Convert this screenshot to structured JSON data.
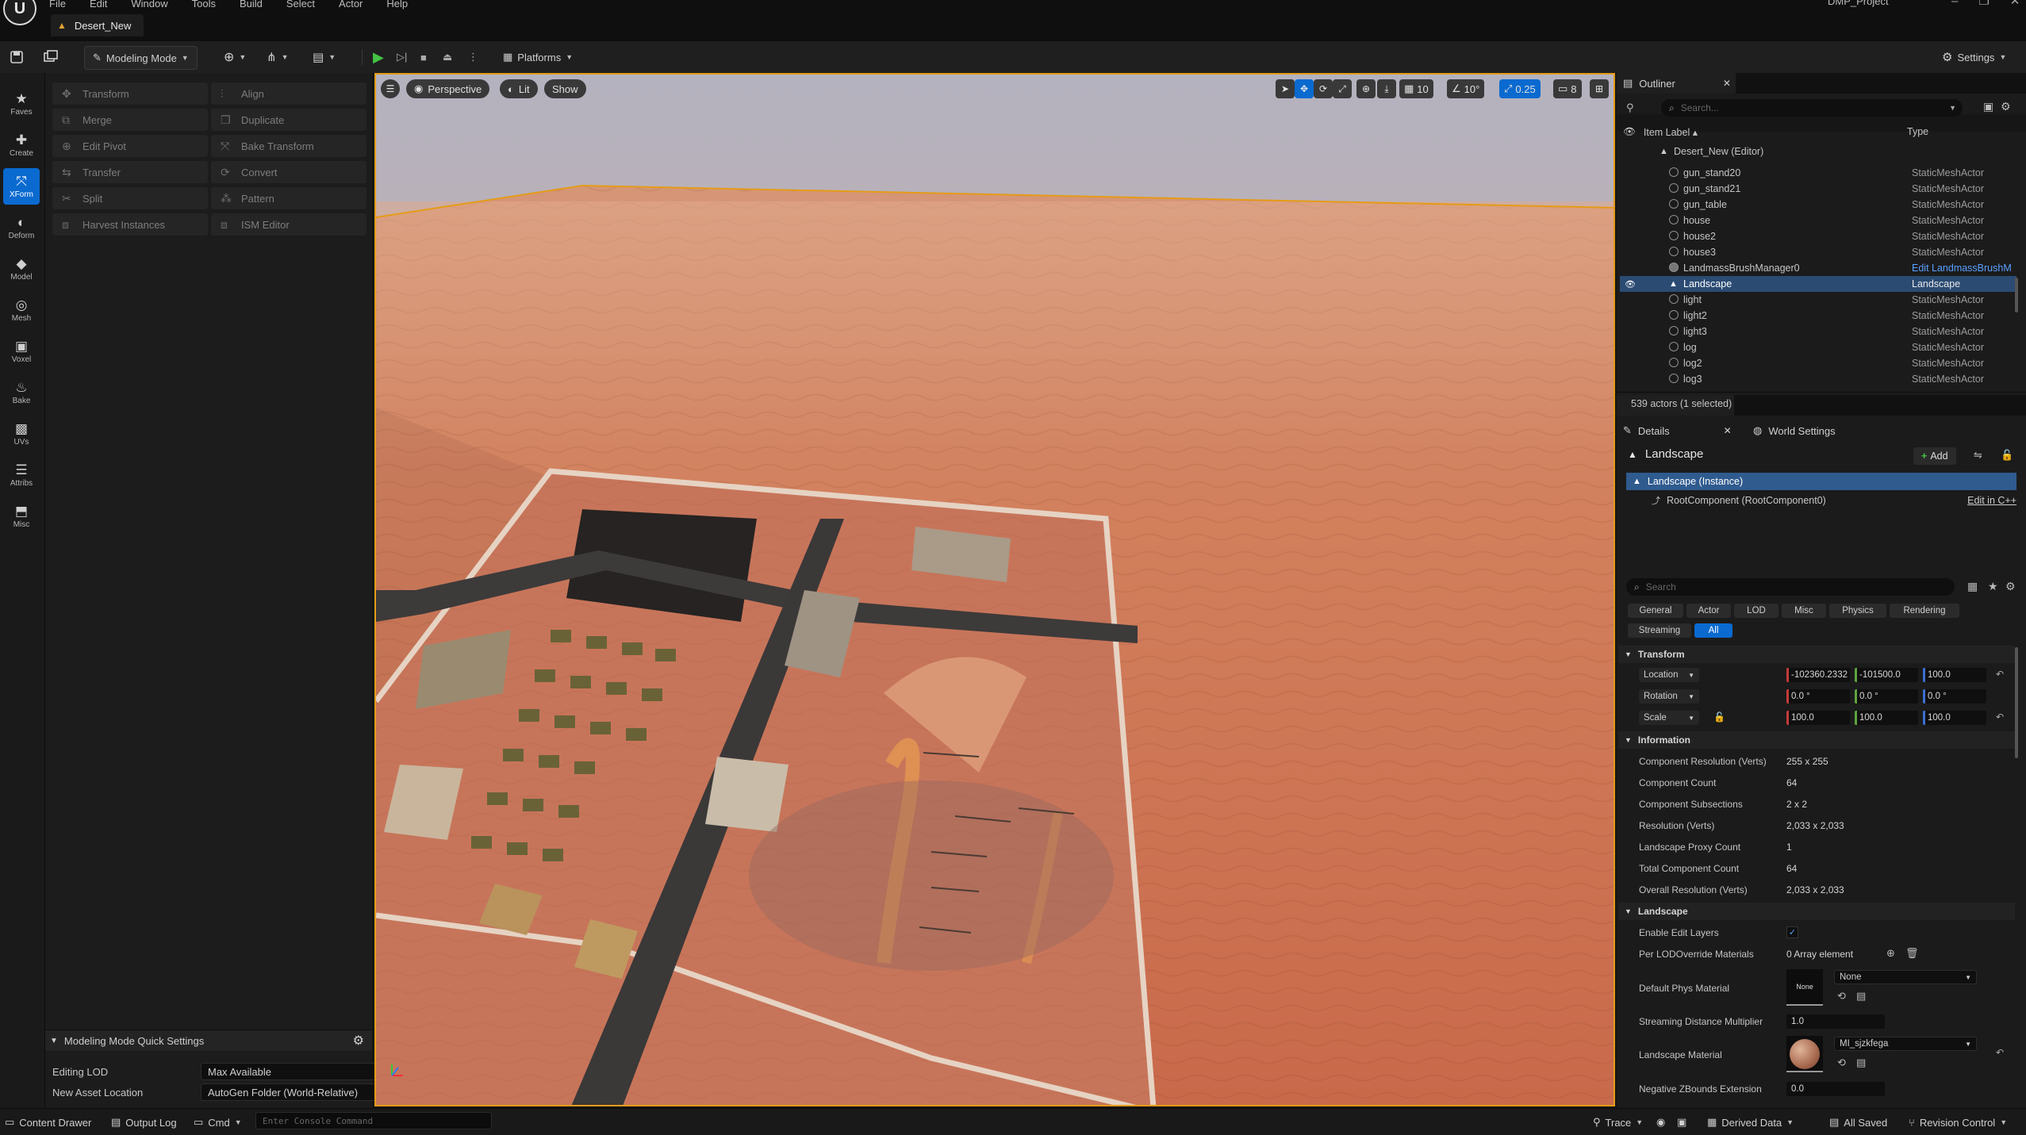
{
  "window": {
    "project_name": "DMP_Project",
    "level_tab": "Desert_New",
    "menu": [
      "File",
      "Edit",
      "Window",
      "Tools",
      "Build",
      "Select",
      "Actor",
      "Help"
    ]
  },
  "toolbar": {
    "mode": "Modeling Mode",
    "platforms": "Platforms",
    "settings": "Settings"
  },
  "rail": [
    {
      "label": "Faves",
      "icon": "star-icon"
    },
    {
      "label": "Create",
      "icon": "create-icon"
    },
    {
      "label": "XForm",
      "icon": "xform-icon",
      "active": true
    },
    {
      "label": "Deform",
      "icon": "deform-icon"
    },
    {
      "label": "Model",
      "icon": "model-icon"
    },
    {
      "label": "Mesh",
      "icon": "mesh-icon"
    },
    {
      "label": "Voxel",
      "icon": "voxel-icon"
    },
    {
      "label": "Bake",
      "icon": "bake-icon"
    },
    {
      "label": "UVs",
      "icon": "uvs-icon"
    },
    {
      "label": "Attribs",
      "icon": "attribs-icon"
    },
    {
      "label": "Misc",
      "icon": "misc-icon"
    }
  ],
  "palette": {
    "left": [
      "Transform",
      "Merge",
      "Edit Pivot",
      "Transfer",
      "Split",
      "Harvest Instances"
    ],
    "right": [
      "Align",
      "Duplicate",
      "Bake Transform",
      "Convert",
      "Pattern",
      "ISM Editor"
    ]
  },
  "quick_settings": {
    "header": "Modeling Mode Quick Settings",
    "editing_lod_label": "Editing LOD",
    "editing_lod_value": "Max Available",
    "asset_location_label": "New Asset Location",
    "asset_location_value": "AutoGen Folder (World-Relative)"
  },
  "viewport": {
    "perspective": "Perspective",
    "lit": "Lit",
    "show": "Show",
    "grid_snap": "10",
    "rot_snap": "10°",
    "scale_snap": "0.25",
    "camera_speed": "8"
  },
  "outliner": {
    "title": "Outliner",
    "search_placeholder": "Search...",
    "col_label": "Item Label ▴",
    "col_type": "Type",
    "root": "Desert_New (Editor)",
    "rows": [
      {
        "name": "gun_stand20",
        "type": "StaticMeshActor"
      },
      {
        "name": "gun_stand21",
        "type": "StaticMeshActor"
      },
      {
        "name": "gun_table",
        "type": "StaticMeshActor"
      },
      {
        "name": "house",
        "type": "StaticMeshActor"
      },
      {
        "name": "house2",
        "type": "StaticMeshActor"
      },
      {
        "name": "house3",
        "type": "StaticMeshActor"
      },
      {
        "name": "LandmassBrushManager0",
        "type": "Edit LandmassBrushM"
      },
      {
        "name": "Landscape",
        "type": "Landscape",
        "selected": true
      },
      {
        "name": "light",
        "type": "StaticMeshActor"
      },
      {
        "name": "light2",
        "type": "StaticMeshActor"
      },
      {
        "name": "light3",
        "type": "StaticMeshActor"
      },
      {
        "name": "log",
        "type": "StaticMeshActor"
      },
      {
        "name": "log2",
        "type": "StaticMeshActor"
      },
      {
        "name": "log3",
        "type": "StaticMeshActor"
      }
    ],
    "footer": "539 actors (1 selected)"
  },
  "details": {
    "tab": "Details",
    "world_tab": "World Settings",
    "actor_name": "Landscape",
    "add_label": "Add",
    "instance": "Landscape (Instance)",
    "root_component": "RootComponent (RootComponent0)",
    "edit_cpp": "Edit in C++",
    "search_placeholder": "Search",
    "filters": [
      "General",
      "Actor",
      "LOD",
      "Misc",
      "Physics",
      "Rendering",
      "Streaming",
      "All"
    ],
    "transform": {
      "header": "Transform",
      "location_label": "Location",
      "rotation_label": "Rotation",
      "scale_label": "Scale",
      "location": [
        "-102360.2332",
        "-101500.0",
        "100.0"
      ],
      "rotation": [
        "0.0 °",
        "0.0 °",
        "0.0 °"
      ],
      "scale": [
        "100.0",
        "100.0",
        "100.0"
      ]
    },
    "information": {
      "header": "Information",
      "rows": [
        {
          "label": "Component Resolution (Verts)",
          "value": "255 x 255"
        },
        {
          "label": "Component Count",
          "value": "64"
        },
        {
          "label": "Component Subsections",
          "value": "2 x 2"
        },
        {
          "label": "Resolution (Verts)",
          "value": "2,033 x 2,033"
        },
        {
          "label": "Landscape Proxy Count",
          "value": "1"
        },
        {
          "label": "Total Component Count",
          "value": "64"
        },
        {
          "label": "Overall Resolution (Verts)",
          "value": "2,033 x 2,033"
        }
      ]
    },
    "landscape": {
      "header": "Landscape",
      "enable_edit_layers": "Enable Edit Layers",
      "per_lod_override": "Per LODOverride Materials",
      "array_elements": "0 Array element",
      "default_phys_material": "Default Phys Material",
      "phys_thumb": "None",
      "phys_value": "None",
      "streaming_multiplier_label": "Streaming Distance Multiplier",
      "streaming_multiplier": "1.0",
      "material_label": "Landscape Material",
      "material_value": "MI_sjzkfega",
      "negative_z_label": "Negative ZBounds Extension",
      "negative_z": "0.0"
    }
  },
  "statusbar": {
    "content_drawer": "Content Drawer",
    "output_log": "Output Log",
    "cmd": "Cmd",
    "console_placeholder": "Enter Console Command",
    "trace": "Trace",
    "derived_data": "Derived Data",
    "all_saved": "All Saved",
    "revision_control": "Revision Control"
  },
  "colors": {
    "accent": "#0a6ad0",
    "selection_outline": "#e59b17",
    "play_green": "#45c245",
    "sand": "#c46448"
  }
}
